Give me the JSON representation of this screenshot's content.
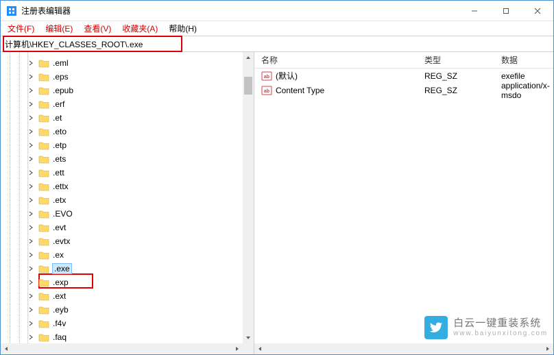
{
  "window": {
    "title": "注册表编辑器"
  },
  "menubar": {
    "items": [
      {
        "label": "文件(F)"
      },
      {
        "label": "编辑(E)"
      },
      {
        "label": "查看(V)"
      },
      {
        "label": "收藏夹(A)"
      },
      {
        "label": "帮助(H)"
      }
    ]
  },
  "addressbar": {
    "value": "计算机\\HKEY_CLASSES_ROOT\\.exe"
  },
  "tree": {
    "items": [
      {
        "label": ".eml",
        "selected": false
      },
      {
        "label": ".eps",
        "selected": false
      },
      {
        "label": ".epub",
        "selected": false
      },
      {
        "label": ".erf",
        "selected": false
      },
      {
        "label": ".et",
        "selected": false
      },
      {
        "label": ".eto",
        "selected": false
      },
      {
        "label": ".etp",
        "selected": false
      },
      {
        "label": ".ets",
        "selected": false
      },
      {
        "label": ".ett",
        "selected": false
      },
      {
        "label": ".ettx",
        "selected": false
      },
      {
        "label": ".etx",
        "selected": false
      },
      {
        "label": ".EVO",
        "selected": false
      },
      {
        "label": ".evt",
        "selected": false
      },
      {
        "label": ".evtx",
        "selected": false
      },
      {
        "label": ".ex",
        "selected": false
      },
      {
        "label": ".exe",
        "selected": true
      },
      {
        "label": ".exp",
        "selected": false
      },
      {
        "label": ".ext",
        "selected": false
      },
      {
        "label": ".eyb",
        "selected": false
      },
      {
        "label": ".f4v",
        "selected": false
      },
      {
        "label": ".faq",
        "selected": false
      }
    ]
  },
  "list": {
    "columns": {
      "name": "名称",
      "type": "类型",
      "data": "数据"
    },
    "rows": [
      {
        "name": "(默认)",
        "type": "REG_SZ",
        "data": "exefile"
      },
      {
        "name": "Content Type",
        "type": "REG_SZ",
        "data": "application/x-msdo"
      }
    ]
  },
  "watermark": {
    "line1": "白云一键重装系统",
    "line2": "www.baiyunxitong.com"
  }
}
